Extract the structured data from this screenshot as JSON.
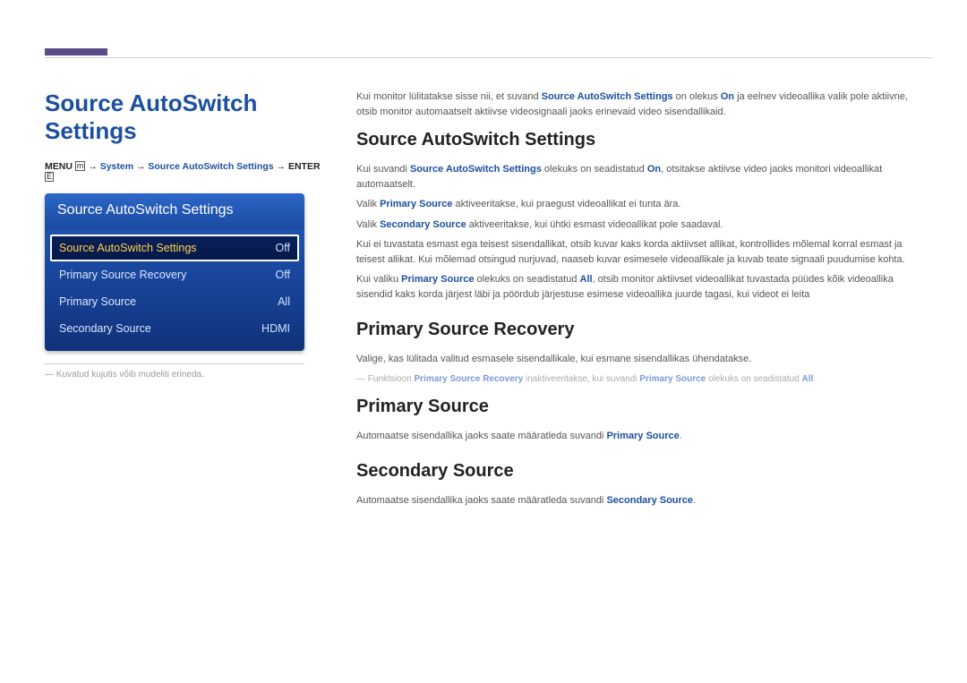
{
  "page_title": "Source AutoSwitch Settings",
  "breadcrumb": {
    "menu": "MENU",
    "menu_icon": "m",
    "arrow": " → ",
    "system": "System",
    "item": "Source AutoSwitch Settings",
    "enter": "ENTER",
    "enter_icon": "E"
  },
  "osd": {
    "header": "Source AutoSwitch Settings",
    "rows": [
      {
        "label": "Source AutoSwitch Settings",
        "value": "Off",
        "selected": true
      },
      {
        "label": "Primary Source Recovery",
        "value": "Off",
        "selected": false
      },
      {
        "label": "Primary Source",
        "value": "All",
        "selected": false
      },
      {
        "label": "Secondary Source",
        "value": "HDMI",
        "selected": false
      }
    ]
  },
  "footnote_prefix": "―",
  "footnote": "Kuvatud kujutis võib mudeliti erineda.",
  "intro": {
    "p1_a": "Kui monitor lülitatakse sisse nii, et suvand ",
    "p1_b": "Source AutoSwitch Settings",
    "p1_c": " on olekus ",
    "p1_d": "On",
    "p1_e": " ja eelnev videoallika valik pole aktiivne, otsib monitor automaatselt aktiivse videosignaali jaoks erinevaid video sisendallikaid."
  },
  "sec_sas": {
    "heading": "Source AutoSwitch Settings",
    "p1_a": "Kui suvandi ",
    "p1_b": "Source AutoSwitch Settings",
    "p1_c": " olekuks on seadistatud ",
    "p1_d": "On",
    "p1_e": ", otsitakse aktiivse video jaoks monitori videoallikat automaatselt.",
    "p2_a": "Valik ",
    "p2_b": "Primary Source",
    "p2_c": " aktiveeritakse, kui praegust videoallikat ei tunta ära.",
    "p3_a": "Valik ",
    "p3_b": "Secondary Source",
    "p3_c": " aktiveeritakse, kui ühtki esmast videoallikat pole saadaval.",
    "p4": "Kui ei tuvastata esmast ega teisest sisendallikat, otsib kuvar kaks korda aktiivset allikat, kontrollides mõlemal korral esmast ja teisest allikat. Kui mõlemad otsingud nurjuvad, naaseb kuvar esimesele videoallikale ja kuvab teate signaali puudumise kohta.",
    "p5_a": "Kui valiku ",
    "p5_b": "Primary Source",
    "p5_c": " olekuks on seadistatud ",
    "p5_d": "All",
    "p5_e": ", otsib monitor aktiivset videoallikat tuvastada püüdes kõik videoallika sisendid kaks korda järjest läbi ja pöördub järjestuse esimese videoallika juurde tagasi, kui videot ei leita"
  },
  "sec_psr": {
    "heading": "Primary Source Recovery",
    "p1": "Valige, kas lülitada valitud esmasele sisendallikale, kui esmane sisendallikas ühendatakse.",
    "note_a": "Funktsioon ",
    "note_b": "Primary Source Recovery",
    "note_c": " inaktiveeritakse, kui suvandi ",
    "note_d": "Primary Source",
    "note_e": " olekuks on seadistatud ",
    "note_f": "All",
    "note_g": "."
  },
  "sec_ps": {
    "heading": "Primary Source",
    "p1_a": "Automaatse sisendallika jaoks saate määratleda suvandi ",
    "p1_b": "Primary Source",
    "p1_c": "."
  },
  "sec_ss": {
    "heading": "Secondary Source",
    "p1_a": "Automaatse sisendallika jaoks saate määratleda suvandi ",
    "p1_b": "Secondary Source",
    "p1_c": "."
  }
}
